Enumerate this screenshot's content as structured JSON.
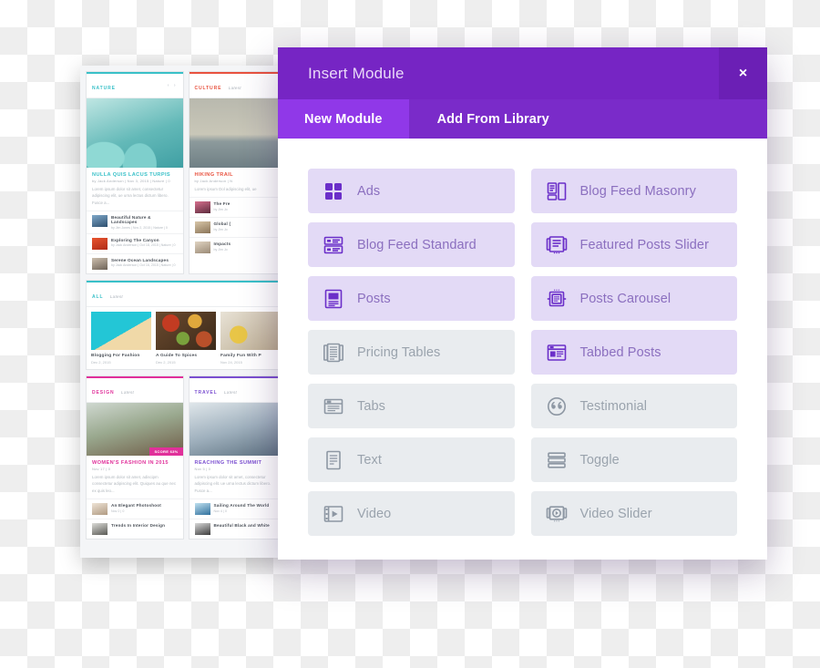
{
  "modal": {
    "title": "Insert Module",
    "close_label": "×",
    "close_icon": "close-icon",
    "tabs": [
      {
        "label": "New Module",
        "active": true
      },
      {
        "label": "Add From Library",
        "active": false
      }
    ],
    "modules": [
      {
        "label": "Ads",
        "icon": "ads-grid-icon",
        "enabled": true,
        "column": "left"
      },
      {
        "label": "Blog Feed Masonry",
        "icon": "masonry-grid-icon",
        "enabled": true,
        "column": "right"
      },
      {
        "label": "Blog Feed Standard",
        "icon": "list-rows-icon",
        "enabled": true,
        "column": "left"
      },
      {
        "label": "Featured Posts Slider",
        "icon": "slider-document-icon",
        "enabled": true,
        "column": "right"
      },
      {
        "label": "Posts",
        "icon": "document-block-icon",
        "enabled": true,
        "column": "left"
      },
      {
        "label": "Posts Carousel",
        "icon": "carousel-document-icon",
        "enabled": true,
        "column": "right"
      },
      {
        "label": "Pricing Tables",
        "icon": "pricing-columns-icon",
        "enabled": false,
        "column": "left"
      },
      {
        "label": "Tabbed Posts",
        "icon": "tabbed-layout-icon",
        "enabled": true,
        "column": "right"
      },
      {
        "label": "Tabs",
        "icon": "tabs-panel-icon",
        "enabled": false,
        "column": "left"
      },
      {
        "label": "Testimonial",
        "icon": "quote-circle-icon",
        "enabled": false,
        "column": "right"
      },
      {
        "label": "Text",
        "icon": "text-document-icon",
        "enabled": false,
        "column": "left"
      },
      {
        "label": "Toggle",
        "icon": "stacked-bars-icon",
        "enabled": false,
        "column": "right"
      },
      {
        "label": "Video",
        "icon": "film-play-icon",
        "enabled": false,
        "column": "left"
      },
      {
        "label": "Video Slider",
        "icon": "video-slider-icon",
        "enabled": false,
        "column": "right"
      }
    ]
  },
  "colors": {
    "header_purple": "#7625c4",
    "tabbar_purple": "#7a2bc9",
    "active_tab_purple": "#9038e8",
    "tile_enabled_bg": "#e3daf6",
    "tile_disabled_bg": "#e9ecef",
    "tile_enabled_text": "#8b6fbf",
    "tile_disabled_text": "#9aa3ad",
    "icon_enabled": "#6b2fc9",
    "icon_disabled": "#8d97a3"
  },
  "background_page": {
    "categories": [
      {
        "name": "NATURE",
        "sub": "",
        "accent": "#39c0c8"
      },
      {
        "name": "CULTURE",
        "sub": "Latest",
        "accent": "#e8523f"
      },
      {
        "name": "ALL",
        "sub": "Latest",
        "accent": "#39c0c8"
      },
      {
        "name": "DESIGN",
        "sub": "Latest",
        "accent": "#e0309a"
      },
      {
        "name": "TRAVEL",
        "sub": "Latest",
        "accent": "#7b4fd0"
      }
    ],
    "arrows": "‹ ›",
    "nature_feature": {
      "title": "NULLA QUIS LACUS TURPIS",
      "meta": "by Jack Anderson | Nov 3, 2015 | Nature | 0",
      "excerpt": "Lorem ipsum dolor sit amet, consectetur adipiscing elit, ue urna lectus dictum libero. Fusce a..."
    },
    "culture_feature": {
      "title": "HIKING TRAIL",
      "meta": "by Jack Anderson | N",
      "excerpt": "Lorem ipsum Dol adipiscing elit, ue"
    },
    "nature_list": [
      {
        "title": "Beautiful Nature & Landscapes",
        "meta": "by Jim Jones | Nov 2, 2015 | Nature | 0"
      },
      {
        "title": "Exploring The Canyon",
        "meta": "by Jack Anderson | Oct 18, 2015 | Nature | 0"
      },
      {
        "title": "Serene Ocean Landscapes",
        "meta": "by Jack Anderson | Oct 16, 2015 | Nature | 0"
      }
    ],
    "culture_list": [
      {
        "title": "The Fre",
        "meta": "by Jim Jo"
      },
      {
        "title": "Global (",
        "meta": "by Jim Jo"
      },
      {
        "title": "Impacts",
        "meta": "by Jim Jo"
      }
    ],
    "all_grid": [
      {
        "title": "Blogging For Fashion",
        "date": "Dec 2, 2015"
      },
      {
        "title": "A Guide To Spices",
        "date": "Dec 2, 2015"
      },
      {
        "title": "Family Fun With P",
        "date": "Nov 24, 2015"
      }
    ],
    "design_card": {
      "badge": "SCORE 63%",
      "title": "WOMEN'S FASHION IN 2015",
      "meta": "Nov 17 | 0",
      "excerpt": "Lorem ipsum dolor sit amet, adiscipm consectetur adipiscing elit. Quiques au que nec ex quis leo...",
      "items": [
        {
          "title": "An Elegant Photoshoot",
          "meta": "Nov 2 | 0"
        },
        {
          "title": "Trends In Interior Design",
          "meta": ""
        }
      ]
    },
    "travel_card": {
      "title": "REACHING THE SUMMIT",
      "meta": "Nov 5 | 0",
      "excerpt": "Lorem ipsum dolor sit amet, consectetur adipiscing elit. ue urna lectus dictum libero. Fusce a...",
      "items": [
        {
          "title": "Sailing Around The World",
          "meta": "Nov 4 | 0"
        },
        {
          "title": "Beautiful Black and White",
          "meta": ""
        }
      ]
    }
  }
}
